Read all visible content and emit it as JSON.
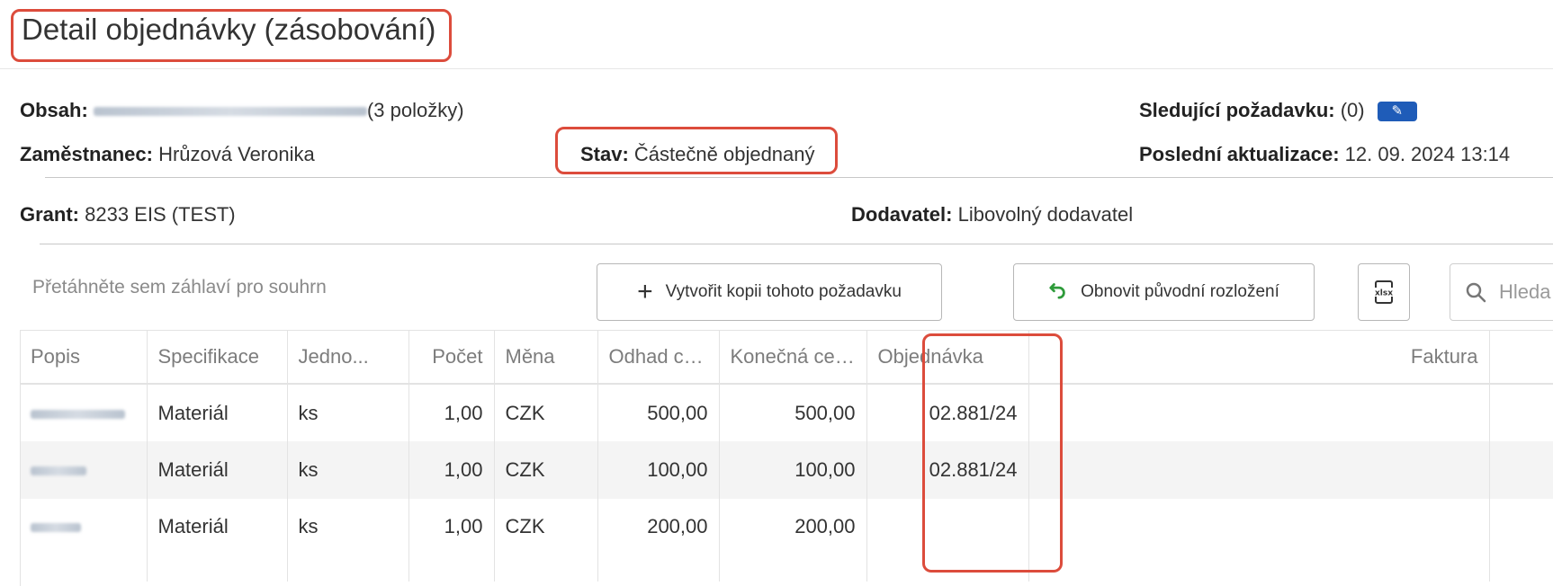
{
  "page": {
    "title": "Detail objednávky (zásobování)"
  },
  "info": {
    "obsah_label": "Obsah:",
    "obsah_suffix": "(3 položky)",
    "sledujici_label": "Sledující požadavku:",
    "sledujici_value": "(0)",
    "zamestnanec_label": "Zaměstnanec:",
    "zamestnanec_value": "Hrůzová Veronika",
    "stav_label": "Stav:",
    "stav_value": "Částečně objednaný",
    "aktualizace_label": "Poslední aktualizace:",
    "aktualizace_value": "12. 09. 2024 13:14",
    "grant_label": "Grant:",
    "grant_value": "8233 EIS (TEST)",
    "dodavatel_label": "Dodavatel:",
    "dodavatel_value": "Libovolný dodavatel"
  },
  "toolbar": {
    "group_hint": "Přetáhněte sem záhlaví pro souhrn",
    "copy_label": "Vytvořit kopii tohoto požadavku",
    "reset_label": "Obnovit původní rozložení",
    "search_placeholder": "Hleda"
  },
  "icons": {
    "plus": "plus-icon",
    "undo": "undo-icon",
    "xlsx": "xlsx-export-icon",
    "search": "search-icon",
    "edit": "pencil-icon"
  },
  "colors": {
    "highlight": "#dc4c3c",
    "edit_button": "#1f5cb8",
    "undo_icon": "#2e9b3a"
  },
  "table": {
    "columns": [
      "Popis",
      "Specifikace",
      "Jedno...",
      "Počet",
      "Měna",
      "Odhad ce...",
      "Konečná cen...",
      "Objednávka",
      "Faktura"
    ],
    "rows": [
      {
        "specifikace": "Materiál",
        "jednotka": "ks",
        "pocet": "1,00",
        "mena": "CZK",
        "odhad": "500,00",
        "konecna": "500,00",
        "objednavka": "02.881/24",
        "faktura": ""
      },
      {
        "specifikace": "Materiál",
        "jednotka": "ks",
        "pocet": "1,00",
        "mena": "CZK",
        "odhad": "100,00",
        "konecna": "100,00",
        "objednavka": "02.881/24",
        "faktura": ""
      },
      {
        "specifikace": "Materiál",
        "jednotka": "ks",
        "pocet": "1,00",
        "mena": "CZK",
        "odhad": "200,00",
        "konecna": "200,00",
        "objednavka": "",
        "faktura": ""
      }
    ]
  }
}
